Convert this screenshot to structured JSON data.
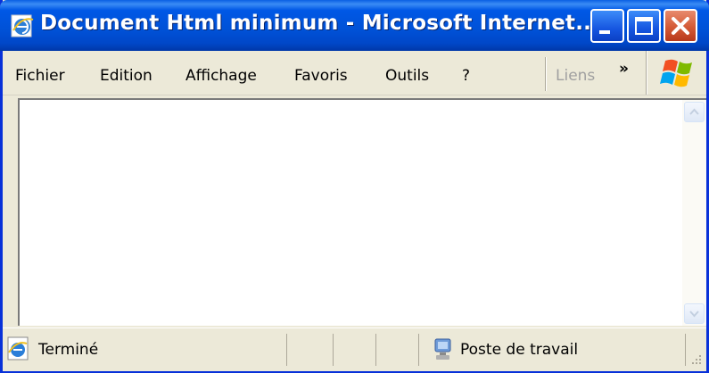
{
  "window": {
    "title": "Document Html minimum - Microsoft Internet...",
    "icon": "internet-explorer-icon"
  },
  "menu": {
    "items": [
      "Fichier",
      "Edition",
      "Affichage",
      "Favoris",
      "Outils",
      "?"
    ],
    "links_label": "Liens",
    "more_label": "»",
    "brand_icon": "windows-flag-icon"
  },
  "status": {
    "text": "Terminé",
    "zone": "Poste de travail",
    "icon": "internet-explorer-page-icon",
    "zone_icon": "computer-icon"
  },
  "colors": {
    "titlebar": "#0054e3",
    "chrome": "#ece9d8",
    "close_button": "#d45a36"
  }
}
